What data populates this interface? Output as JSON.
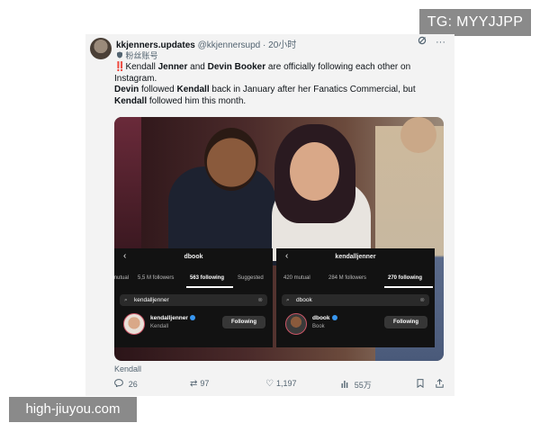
{
  "watermarks": {
    "telegram": "TG: MYYJJPP",
    "site": "high-jiuyou.com"
  },
  "tweet": {
    "display_name": "kkjenners.updates",
    "handle": "@kkjennersupd",
    "separator": "·",
    "time": "20小时",
    "subtitle_icon": "shield-icon",
    "subtitle": "粉丝账号",
    "line1": {
      "alert": "‼️",
      "t1": "Kendall ",
      "b1": "Jenner",
      "t2": " and ",
      "b2": "Devin Booker",
      "t3": " are officially following each other on Instagram."
    },
    "line2": {
      "b1": "Devin",
      "t1": " followed ",
      "b2": "Kendall",
      "t2": " back in January after her Fanatics Commercial, but"
    },
    "line3": {
      "b1": "Kendall",
      "t1": " followed him this month."
    },
    "image_caption": "Kendall",
    "actions": {
      "replies": "26",
      "retweets": "97",
      "likes": "1,197",
      "views": "55万"
    }
  },
  "screens": {
    "left": {
      "back": "‹",
      "title": "dbook",
      "tabs": [
        "mutual",
        "5,5 M followers",
        "563 following",
        "Suggested"
      ],
      "active_tab": "563 following",
      "search": "kendalljenner",
      "result_name": "kendalljenner",
      "result_sub": "Kendall",
      "button": "Following"
    },
    "right": {
      "back": "‹",
      "title": "kendalljenner",
      "tabs": [
        "420 mutual",
        "284 M followers",
        "270 following"
      ],
      "active_tab": "270 following",
      "search": "dbook",
      "result_name": "dbook",
      "result_sub": "Book",
      "button": "Following"
    }
  },
  "colors": {
    "alert": "#d0202a",
    "verified": "#3897f0",
    "panel": "#121212"
  }
}
